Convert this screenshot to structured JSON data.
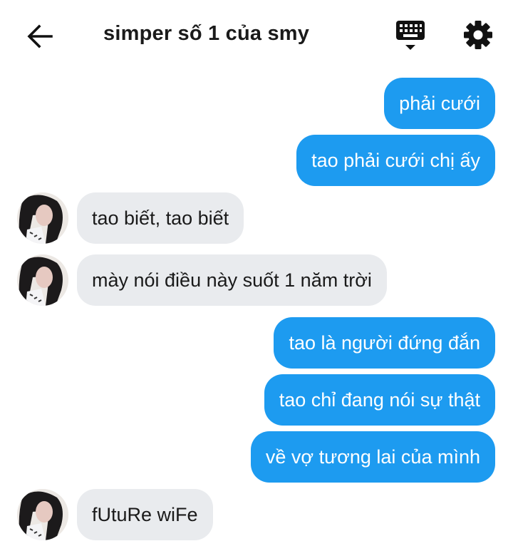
{
  "header": {
    "title": "simper số 1 của smy",
    "icons": {
      "back": "arrow-left-icon",
      "keyboard": "keyboard-icon",
      "settings": "gear-icon"
    }
  },
  "colors": {
    "outgoing_bubble": "#1d9bf0",
    "incoming_bubble": "#e9ebee"
  },
  "messages": [
    {
      "direction": "out",
      "text": "phải cưới"
    },
    {
      "direction": "out",
      "text": "tao phải cưới chị ấy"
    },
    {
      "direction": "in",
      "text": "tao biết, tao biết"
    },
    {
      "direction": "in",
      "text": "mày nói điều này suốt 1 năm trời"
    },
    {
      "direction": "out",
      "text": "tao là người đứng đắn"
    },
    {
      "direction": "out",
      "text": "tao chỉ đang nói sự thật"
    },
    {
      "direction": "out",
      "text": "về vợ tương lai của mình"
    },
    {
      "direction": "in",
      "text": "fUtuRe wiFe"
    }
  ]
}
